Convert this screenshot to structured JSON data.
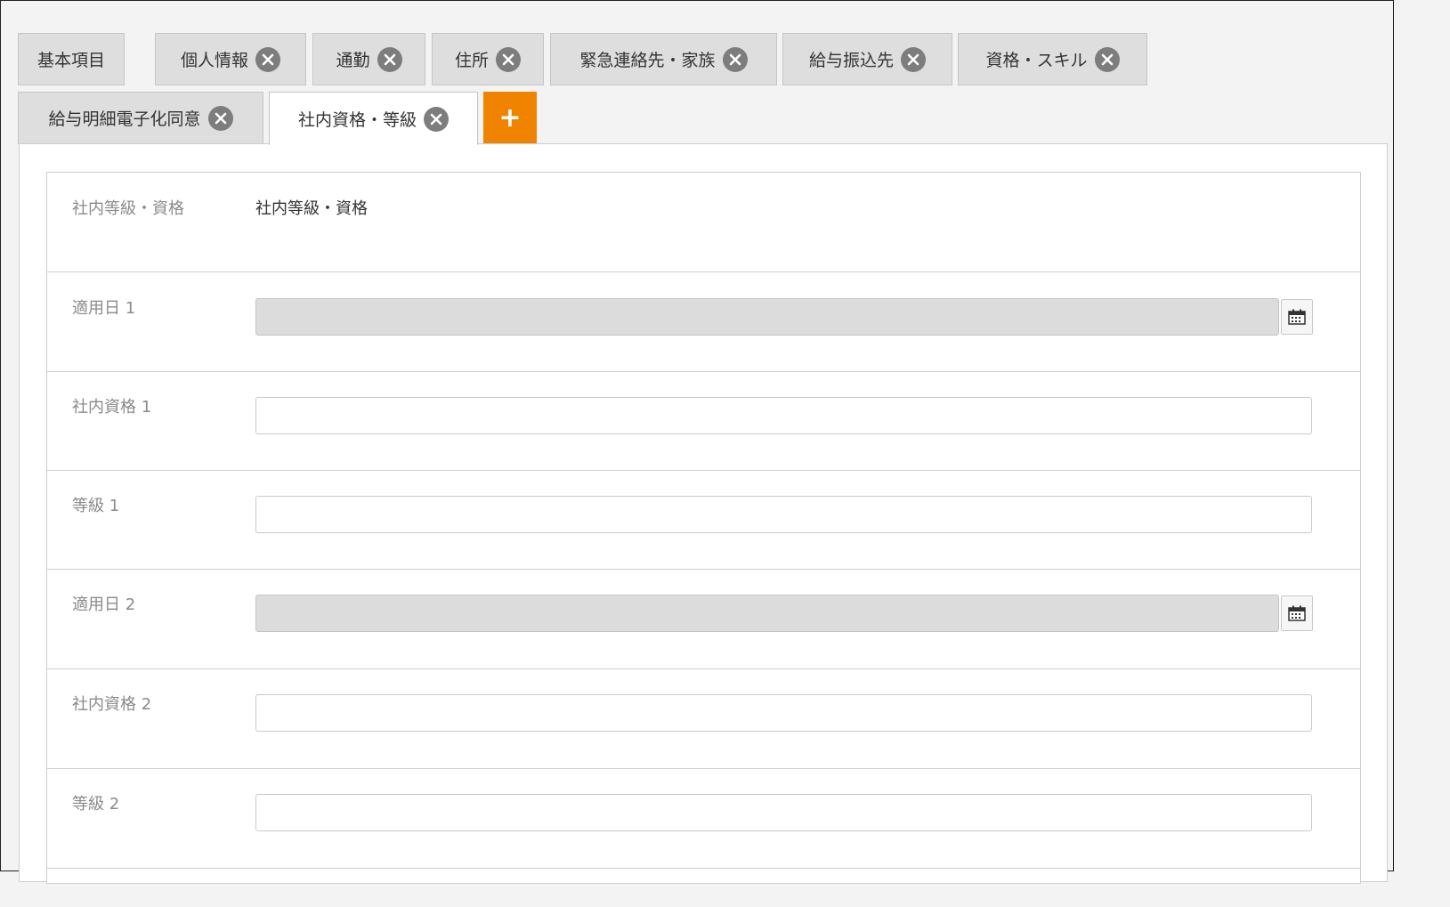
{
  "tabs_row1": [
    {
      "label": "基本項目",
      "closable": false
    },
    {
      "label": "個人情報",
      "closable": true
    },
    {
      "label": "通勤",
      "closable": true
    },
    {
      "label": "住所",
      "closable": true
    },
    {
      "label": "緊急連絡先・家族",
      "closable": true
    },
    {
      "label": "給与振込先",
      "closable": true
    },
    {
      "label": "資格・スキル",
      "closable": true
    }
  ],
  "tabs_row2": [
    {
      "label": "給与明細電子化同意",
      "closable": true
    },
    {
      "label": "社内資格・等級",
      "closable": true,
      "active": true
    }
  ],
  "add_tab_label": "+",
  "form": {
    "header": {
      "label": "社内等級・資格",
      "value": "社内等級・資格"
    },
    "fields": [
      {
        "label": "適用日 1",
        "type": "date",
        "value": ""
      },
      {
        "label": "社内資格 1",
        "type": "text",
        "value": ""
      },
      {
        "label": "等級 1",
        "type": "text",
        "value": ""
      },
      {
        "label": "適用日 2",
        "type": "date",
        "value": ""
      },
      {
        "label": "社内資格 2",
        "type": "text",
        "value": ""
      },
      {
        "label": "等級 2",
        "type": "text",
        "value": ""
      }
    ]
  },
  "colors": {
    "accent": "#f08300",
    "tab_bg": "#dedede",
    "close_icon": "#7d7d7d"
  },
  "icons": {
    "close": "close-icon",
    "calendar": "calendar-icon"
  }
}
